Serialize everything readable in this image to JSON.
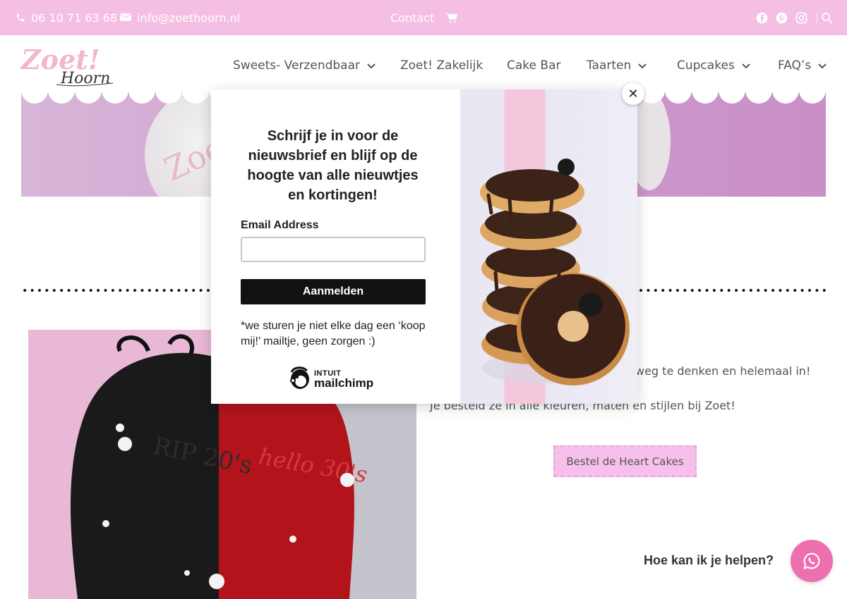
{
  "topbar": {
    "phone": "06 10 71 63 68",
    "email": "info@zoethoorn.nl",
    "contact": "Contact",
    "icons": [
      "phone-icon",
      "mail-icon",
      "cart-icon",
      "facebook-icon",
      "pinterest-icon",
      "instagram-icon",
      "search-icon"
    ]
  },
  "header": {
    "logo_brand": "Zoet!",
    "logo_sub": "Hoorn",
    "nav": [
      {
        "label": "Sweets- Verzendbaar",
        "dropdown": true
      },
      {
        "label": "Zoet! Zakelijk",
        "dropdown": false
      },
      {
        "label": "Cake Bar",
        "dropdown": false
      },
      {
        "label": "Taarten",
        "dropdown": true
      },
      {
        "label": "Cupcakes",
        "dropdown": true
      },
      {
        "label": "FAQ’s",
        "dropdown": true
      }
    ]
  },
  "hero": {
    "plate_text": "Zoet!"
  },
  "content": {
    "text_line1_visible": "weg te denken en helemaal in!",
    "text_line2": "Je besteld ze in alle kleuren, maten en stijlen bij Zoet!",
    "cta_label": "Bestel de Heart Cakes",
    "cake_text_left": "RIP 20's",
    "cake_text_right": "hello 30's"
  },
  "popup": {
    "title": "Schrijf je in voor de nieuwsbrief en blijf op de hoogte van alle nieuwtjes en kortingen!",
    "email_label": "Email Address",
    "email_value": "",
    "submit_label": "Aanmelden",
    "note": "*we sturen je niet elke dag een ‘koop mij!’ mailtje, geen zorgen :)",
    "brand_small": "INTUIT",
    "brand": "mailchimp",
    "close_label": "✕"
  },
  "help_widget": {
    "label": "Hoe kan ik je helpen?"
  },
  "colors": {
    "topbar_bg": "#f4bfe3",
    "cta_bg": "#f7c0ec",
    "whatsapp_bg": "#ee6fae",
    "button_black": "#111111"
  }
}
